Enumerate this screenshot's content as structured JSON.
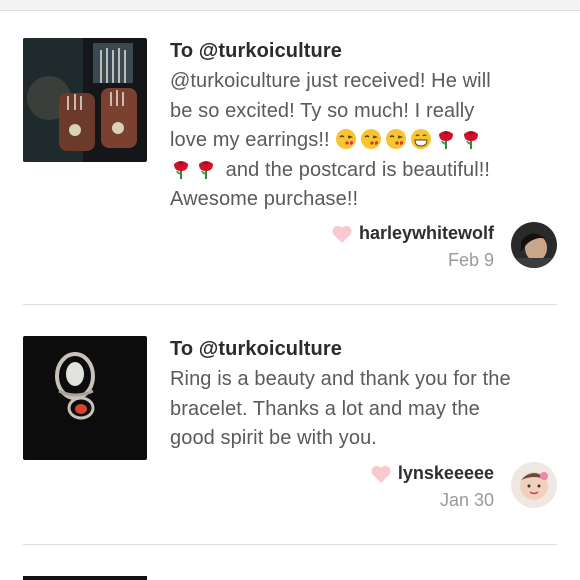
{
  "reviews": [
    {
      "to": "To @turkoiculture",
      "text_line1": "@turkoiculture just received! He will",
      "text_line2": "be so excited! Ty so much! I really",
      "text_line3a": "love my earrings!!",
      "text_line4b": "and the postcard is beautiful!!",
      "text_line5": "Awesome purchase!!",
      "emojis_line3": [
        "kiss-face",
        "kiss-face",
        "kiss-face",
        "grin-face",
        "rose",
        "rose"
      ],
      "emojis_line4": [
        "rose",
        "rose"
      ],
      "username": "harleywhitewolf",
      "date": "Feb 9",
      "heart_icon": "heart-icon"
    },
    {
      "to": "To @turkoiculture",
      "text_line1": "Ring is a beauty and thank you for the",
      "text_line2": "bracelet. Thanks a lot and may the",
      "text_line3": "good spirit be with you.",
      "username": "lynskeeeee",
      "date": "Jan 30",
      "heart_icon": "heart-icon"
    }
  ],
  "colors": {
    "heart": "#f8c9cf",
    "text_primary": "#2b2b2b",
    "text_body": "#5a5a5a",
    "text_muted": "#9a9a9a",
    "divider": "#dddddd"
  }
}
